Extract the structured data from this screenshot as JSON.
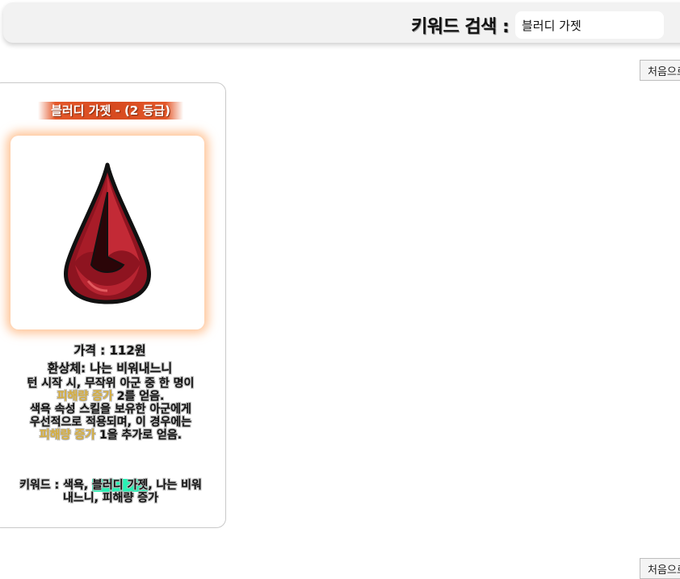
{
  "header": {
    "search_label": "키워드 검색 :",
    "search_value": "블러디 가젯"
  },
  "buttons": {
    "to_first_top": "처음으로",
    "to_first_bottom": "처음으로"
  },
  "card": {
    "title": "블러디 가젯 - (2 등급)",
    "image_icon": "blood-drop-gem-icon",
    "price": "가격 : 112원",
    "owner": "환상체: 나는 비워내느니",
    "description": {
      "line1": "턴 시작 시, 무작위 아군 중 한 명이",
      "hl1": "피해량 증가",
      "line2_rest": " 2를 얻음.",
      "line3": "색욕 속성 스킬을 보유한 아군에게",
      "line4": "우선적으로 적용되며, 이 경우에는",
      "hl2": "피해량 증가",
      "line5_rest": " 1을 추가로 얻음."
    },
    "keywords": {
      "prefix": "키워드 : 색욕, ",
      "highlight": "블러디 가젯",
      "suffix": ", 나는 비워내느니, 피해량 증가"
    }
  },
  "colors": {
    "title_bg": "#d64a1f",
    "highlight_text": "#d6ad3c",
    "keyword_highlight": "#29f0b4",
    "image_glow": "#ffa55f"
  }
}
